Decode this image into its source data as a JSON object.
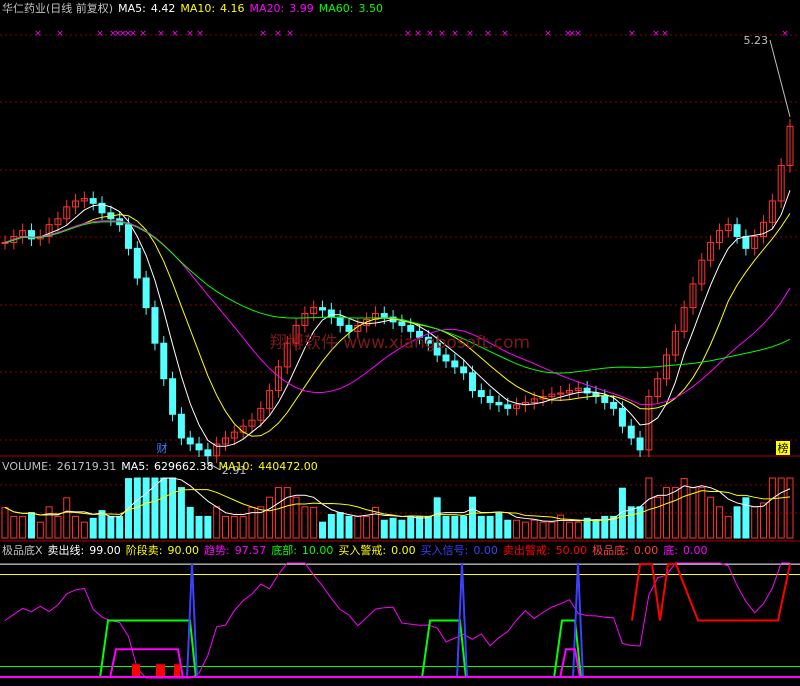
{
  "chart_data": [
    {
      "type": "candlestick",
      "panel": "price",
      "stock_name": "华仁药业",
      "period": "日线",
      "adjust": "前复权",
      "title": "华仁药业(日线 前复权)",
      "ma": [
        {
          "label": "MA5:",
          "value": "4.42",
          "color": "#ffffff"
        },
        {
          "label": "MA10:",
          "value": "4.16",
          "color": "#ffff00"
        },
        {
          "label": "MA20:",
          "value": "3.99",
          "color": "#ff00ff"
        },
        {
          "label": "MA60:",
          "value": "3.50",
          "color": "#00ff00"
        }
      ],
      "annotations": {
        "high": "5.23",
        "low": "2.91",
        "marker_1": "财",
        "marker_2": "榜"
      },
      "watermark": "翔博软件 www.xiangbosoft.com",
      "close_series": [
        4.25,
        4.3,
        4.35,
        4.28,
        4.3,
        4.4,
        4.45,
        4.55,
        4.6,
        4.62,
        4.58,
        4.5,
        4.45,
        4.4,
        4.2,
        3.95,
        3.7,
        3.4,
        3.1,
        2.8,
        2.6,
        2.55,
        2.5,
        2.45,
        2.55,
        2.6,
        2.65,
        2.7,
        2.75,
        2.85,
        3.0,
        3.2,
        3.4,
        3.55,
        3.65,
        3.7,
        3.68,
        3.62,
        3.55,
        3.5,
        3.55,
        3.6,
        3.65,
        3.62,
        3.58,
        3.55,
        3.5,
        3.45,
        3.4,
        3.3,
        3.25,
        3.2,
        3.15,
        3.0,
        2.95,
        2.9,
        2.88,
        2.85,
        2.88,
        2.9,
        2.93,
        2.95,
        2.97,
        2.98,
        3.0,
        3.02,
        2.98,
        2.95,
        2.9,
        2.85,
        2.7,
        2.6,
        2.5,
        2.95,
        3.1,
        3.3,
        3.5,
        3.7,
        3.9,
        4.1,
        4.25,
        4.35,
        4.4,
        4.3,
        4.2,
        4.3,
        4.42,
        4.6,
        4.9,
        5.23
      ]
    },
    {
      "type": "bar",
      "panel": "volume",
      "label": "VOLUME:",
      "value": "261719.31",
      "ma": [
        {
          "label": "MA5:",
          "value": "629662.38",
          "color": "#ffffff"
        },
        {
          "label": "MA10:",
          "value": "440472.00",
          "color": "#ffff00"
        }
      ]
    },
    {
      "type": "line",
      "panel": "indicator",
      "name": "极品底X",
      "fields": [
        {
          "label": "卖出线:",
          "value": "99.00",
          "color": "#ffffff"
        },
        {
          "label": "阶段卖:",
          "value": "90.00",
          "color": "#ffff00"
        },
        {
          "label": "趋势:",
          "value": "97.57",
          "color": "#ff00ff"
        },
        {
          "label": "底部:",
          "value": "10.00",
          "color": "#00ff00"
        },
        {
          "label": "买入警戒:",
          "value": "0.00",
          "color": "#ffff00"
        },
        {
          "label": "买入信号:",
          "value": "0.00",
          "color": "#3f3fff"
        },
        {
          "label": "卖出警戒:",
          "value": "50.00",
          "color": "#ff0000"
        },
        {
          "label": "极品底:",
          "value": "0.00",
          "color": "#ff3f3f"
        },
        {
          "label": "底:",
          "value": "0.00",
          "color": "#ff00ff"
        }
      ]
    }
  ],
  "colors": {
    "up": "#ff3333",
    "down": "#54ffff",
    "ma5": "#ffffff",
    "ma10": "#ffff00",
    "ma20": "#ff00ff",
    "ma60": "#00ff00",
    "grid": "#8b0000",
    "label": "#c0c0c0"
  }
}
